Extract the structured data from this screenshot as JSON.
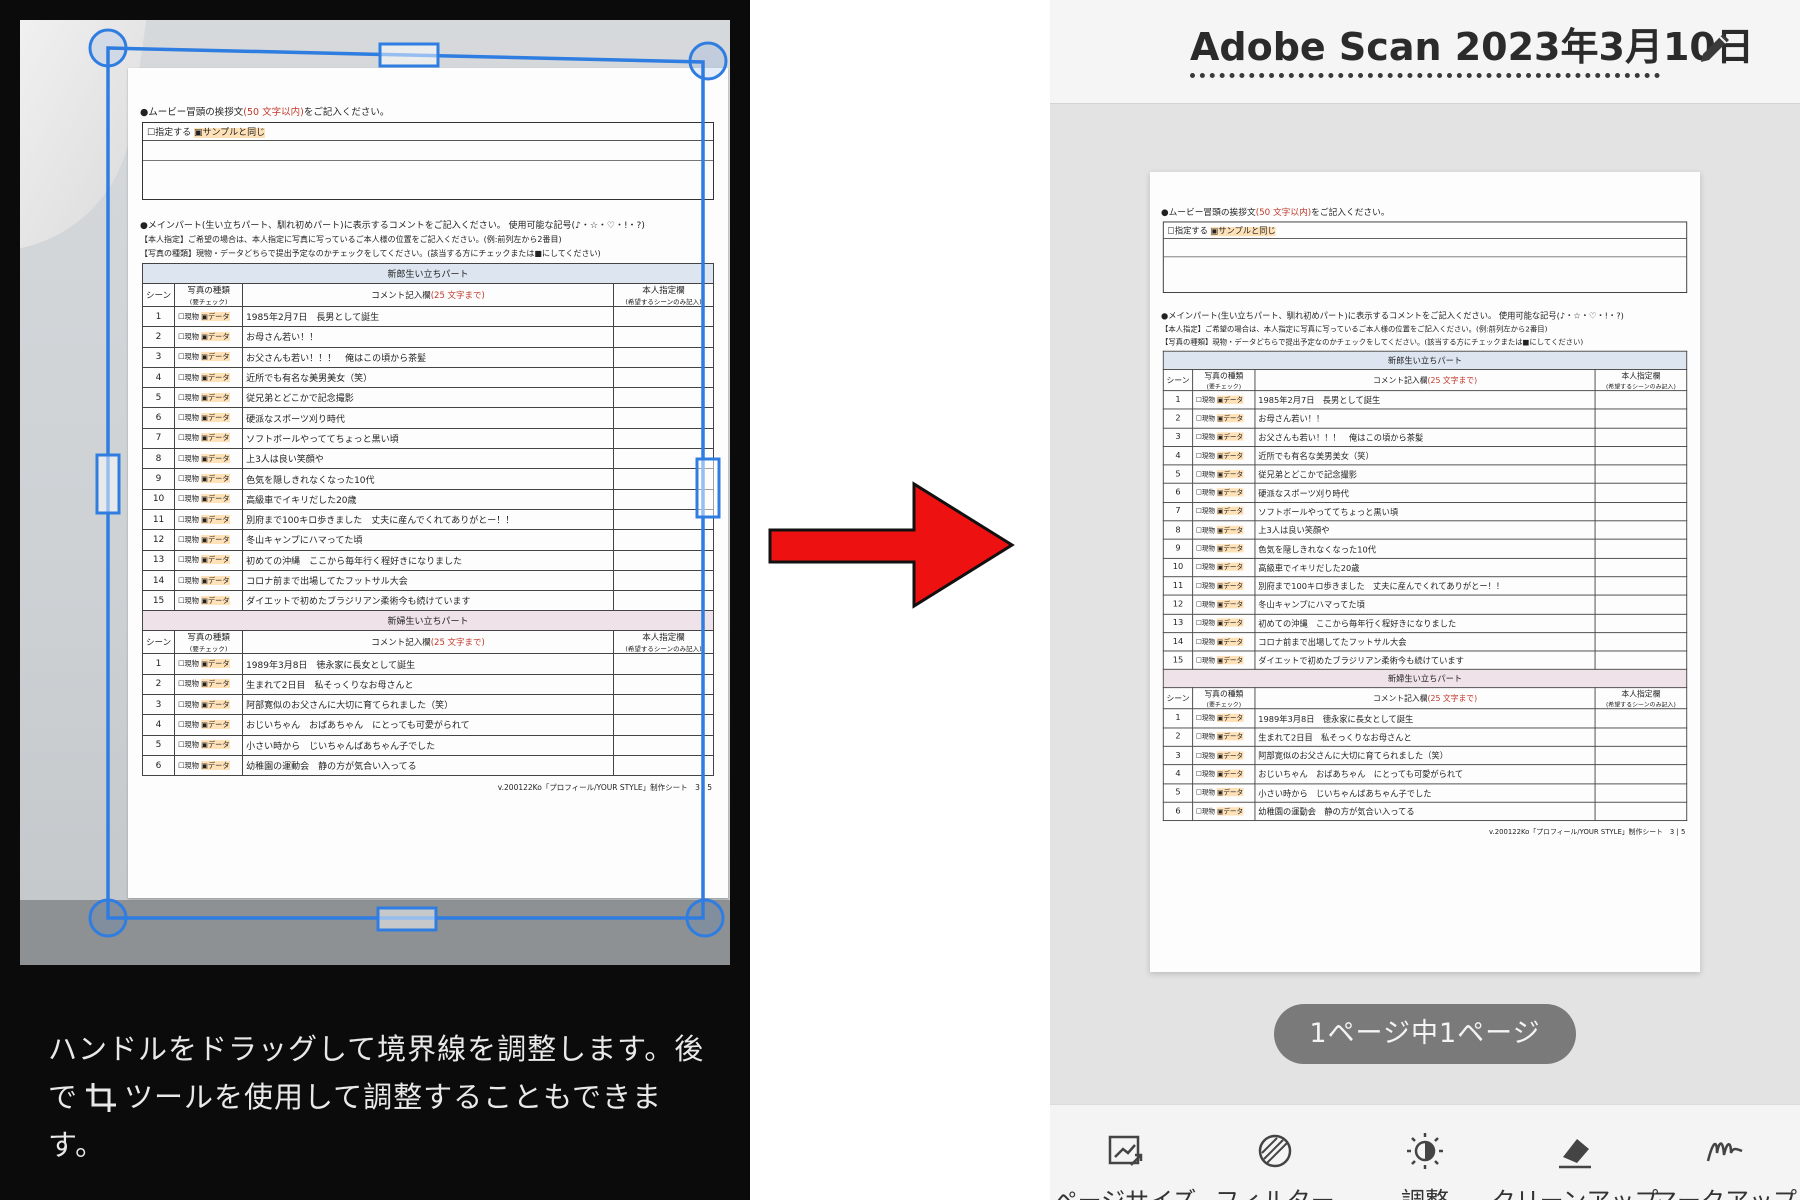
{
  "crop_screen": {
    "instruction_before": "ハンドルをドラッグして境界線を調整します。後で",
    "instruction_after": "ツールを使用して調整することもできます。",
    "crop_tool_icon": "crop-icon"
  },
  "result_screen": {
    "title": "Adobe Scan 2023年3月10日",
    "edit_icon": "pencil-icon",
    "page_indicator": "1ページ中1ページ",
    "toolbar": [
      {
        "label": "ページサイズ",
        "icon": "resize-icon"
      },
      {
        "label": "フィルター",
        "icon": "filter-icon"
      },
      {
        "label": "調整",
        "icon": "brightness-icon"
      },
      {
        "label": "クリーンアップ",
        "icon": "eraser-icon"
      },
      {
        "label": "マークアップ",
        "icon": "signature-icon"
      }
    ]
  },
  "colors": {
    "crop_handle": "#2f7de1",
    "arrow": "#ee1111",
    "pill": "#7a7a7a"
  },
  "document": {
    "greeting_heading": "●ムービー冒頭の挨拶文",
    "greeting_limit": "(50 文字以内)",
    "greeting_tail": "をご記入ください。",
    "opt_specify": "☐指定する",
    "opt_same": "▣サンプルと同じ",
    "main_heading": "●メインパート(生い立ちパート、馴れ初めパート)に表示するコメントをご記入ください。 使用可能な記号(♪・☆・♡・!・?)",
    "note1": "【本人指定】ご希望の場合は、本人指定に写真に写っているご本人様の位置をご記入ください。(例:前列左から2番目)",
    "note2": "【写真の種類】現物・データどちらで提出予定なのかチェックをしてください。(該当する方にチェックまたは■にしてください)",
    "groom_section": "新郎生い立ちパート",
    "bride_section": "新婦生い立ちパート",
    "col_scene": "シーン",
    "col_type": "写真の種類",
    "col_type_sub": "(要チェック)",
    "col_comment": "コメント記入欄",
    "col_comment_limit": "(25 文字まで)",
    "col_note": "本人指定欄",
    "col_note_sub": "(希望するシーンのみ記入)",
    "type_physical": "☐現物",
    "type_data": "▣データ",
    "groom_rows": [
      {
        "scene": "1",
        "comment": "1985年2月7日　長男として誕生"
      },
      {
        "scene": "2",
        "comment": "お母さん若い！！"
      },
      {
        "scene": "3",
        "comment": "お父さんも若い！！！　俺はこの頃から茶髪"
      },
      {
        "scene": "4",
        "comment": "近所でも有名な美男美女（笑）"
      },
      {
        "scene": "5",
        "comment": "従兄弟とどこかで記念撮影"
      },
      {
        "scene": "6",
        "comment": "硬派なスポーツ刈り時代"
      },
      {
        "scene": "7",
        "comment": "ソフトボールやっててちょっと黒い頃"
      },
      {
        "scene": "8",
        "comment": "上3人は良い笑顔や"
      },
      {
        "scene": "9",
        "comment": "色気を隠しきれなくなった10代"
      },
      {
        "scene": "10",
        "comment": "高級車でイキリだした20歳"
      },
      {
        "scene": "11",
        "comment": "別府まで100キロ歩きました　丈夫に産んでくれてありがとー！！"
      },
      {
        "scene": "12",
        "comment": "冬山キャンプにハマってた頃"
      },
      {
        "scene": "13",
        "comment": "初めての沖縄　ここから毎年行く程好きになりました"
      },
      {
        "scene": "14",
        "comment": "コロナ前まで出場してたフットサル大会"
      },
      {
        "scene": "15",
        "comment": "ダイエットで初めたブラジリアン柔術今も続けています"
      }
    ],
    "bride_rows": [
      {
        "scene": "1",
        "comment": "1989年3月8日　徳永家に長女として誕生"
      },
      {
        "scene": "2",
        "comment": "生まれて2日目　私そっくりなお母さんと"
      },
      {
        "scene": "3",
        "comment": "阿部寛似のお父さんに大切に育てられました（笑）"
      },
      {
        "scene": "4",
        "comment": "おじいちゃん　おばあちゃん　にとっても可愛がられて"
      },
      {
        "scene": "5",
        "comment": "小さい時から　じいちゃんばあちゃん子でした"
      },
      {
        "scene": "6",
        "comment": "幼稚園の運動会　静の方が気合い入ってる"
      }
    ],
    "footer": "v.200122Ko「プロフィール/YOUR STYLE」制作シート　3 | 5"
  }
}
